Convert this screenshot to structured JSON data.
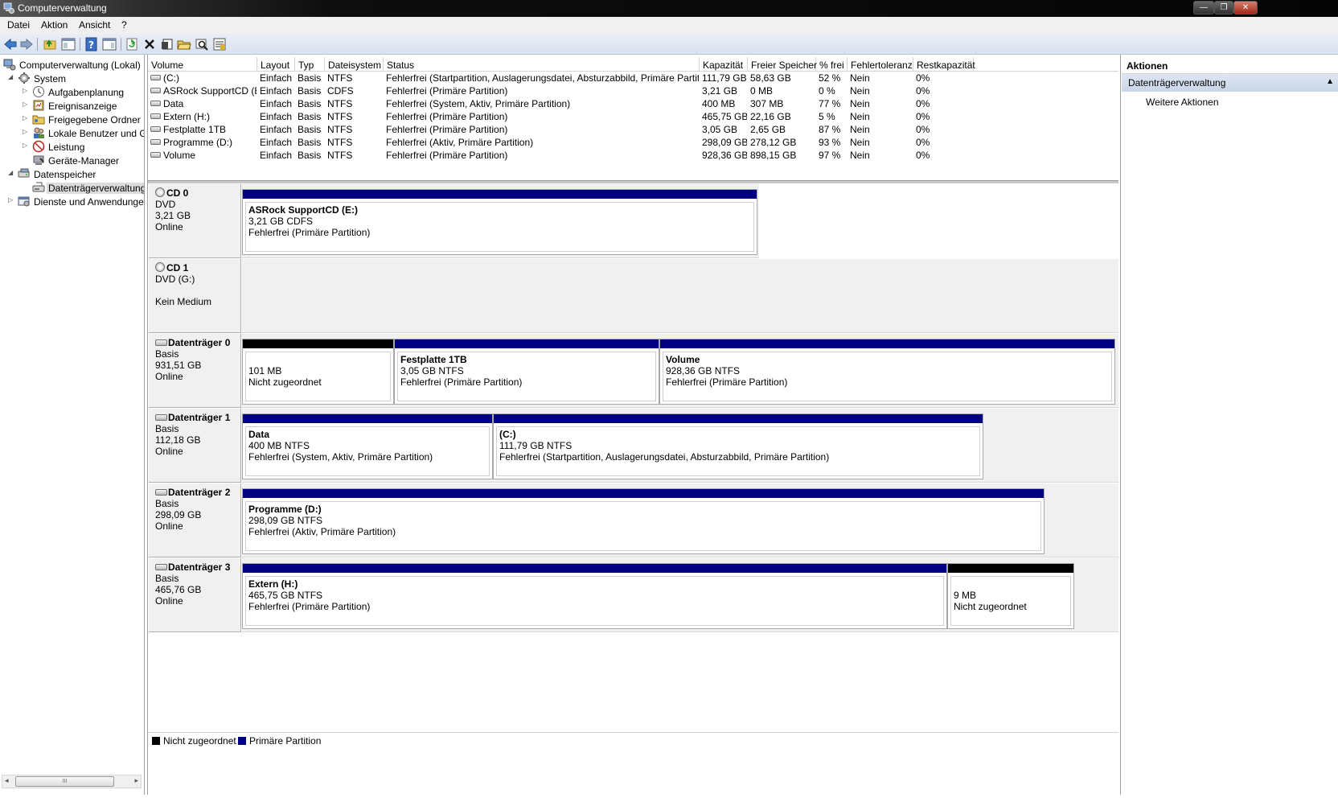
{
  "window": {
    "title": "Computerverwaltung",
    "buttons": [
      "—",
      "❐",
      "✕"
    ]
  },
  "menubar": {
    "items": [
      "Datei",
      "Aktion",
      "Ansicht",
      "?"
    ]
  },
  "tree": {
    "items": [
      {
        "label": "Computerverwaltung (Lokal)",
        "icon": "computer-management-icon",
        "expand": ""
      },
      {
        "label": "System",
        "icon": "system-icon",
        "expand": "◢"
      },
      {
        "label": "Aufgabenplanung",
        "icon": "clock-icon",
        "expand": "▷"
      },
      {
        "label": "Ereignisanzeige",
        "icon": "event-viewer-icon",
        "expand": "▷"
      },
      {
        "label": "Freigegebene Ordner",
        "icon": "shared-folder-icon",
        "expand": "▷"
      },
      {
        "label": "Lokale Benutzer und Gruppen",
        "icon": "users-icon",
        "expand": "▷"
      },
      {
        "label": "Leistung",
        "icon": "performance-icon",
        "expand": "▷"
      },
      {
        "label": "Geräte-Manager",
        "icon": "device-manager-icon",
        "expand": ""
      },
      {
        "label": "Datenspeicher",
        "icon": "storage-icon",
        "expand": "◢"
      },
      {
        "label": "Datenträgerverwaltung",
        "icon": "disk-management-icon",
        "expand": ""
      },
      {
        "label": "Dienste und Anwendungen",
        "icon": "services-icon",
        "expand": "▷"
      }
    ],
    "scroll_label": "III"
  },
  "volumes": {
    "columns": [
      "Volume",
      "Layout",
      "Typ",
      "Dateisystem",
      "Status",
      "Kapazität",
      "Freier Speicher",
      "% frei",
      "Fehlertoleranz",
      "Restkapazität"
    ],
    "rows": [
      [
        "(C:)",
        "Einfach",
        "Basis",
        "NTFS",
        "Fehlerfrei (Startpartition, Auslagerungsdatei, Absturzabbild, Primäre Partition)",
        "111,79 GB",
        "58,63 GB",
        "52 %",
        "Nein",
        "0%"
      ],
      [
        "ASRock SupportCD (E:)",
        "Einfach",
        "Basis",
        "CDFS",
        "Fehlerfrei (Primäre Partition)",
        "3,21 GB",
        "0 MB",
        "0 %",
        "Nein",
        "0%"
      ],
      [
        "Data",
        "Einfach",
        "Basis",
        "NTFS",
        "Fehlerfrei (System, Aktiv, Primäre Partition)",
        "400 MB",
        "307 MB",
        "77 %",
        "Nein",
        "0%"
      ],
      [
        "Extern (H:)",
        "Einfach",
        "Basis",
        "NTFS",
        "Fehlerfrei (Primäre Partition)",
        "465,75 GB",
        "22,16 GB",
        "5 %",
        "Nein",
        "0%"
      ],
      [
        "Festplatte 1TB",
        "Einfach",
        "Basis",
        "NTFS",
        "Fehlerfrei (Primäre Partition)",
        "3,05 GB",
        "2,65 GB",
        "87 %",
        "Nein",
        "0%"
      ],
      [
        "Programme (D:)",
        "Einfach",
        "Basis",
        "NTFS",
        "Fehlerfrei (Aktiv, Primäre Partition)",
        "298,09 GB",
        "278,12 GB",
        "93 %",
        "Nein",
        "0%"
      ],
      [
        "Volume",
        "Einfach",
        "Basis",
        "NTFS",
        "Fehlerfrei (Primäre Partition)",
        "928,36 GB",
        "898,15 GB",
        "97 %",
        "Nein",
        "0%"
      ]
    ]
  },
  "disks": [
    {
      "name": "CD 0",
      "kind": "DVD",
      "size": "3,21 GB",
      "state": "Online",
      "type": "cd",
      "partitions": [
        {
          "bar": "primary",
          "name": "ASRock SupportCD  (E:)",
          "size": "3,21 GB CDFS",
          "status": "Fehlerfrei (Primäre Partition)"
        }
      ]
    },
    {
      "name": "CD 1",
      "kind": "DVD (G:)",
      "size": "",
      "state": "Kein Medium",
      "type": "cd",
      "partitions": []
    },
    {
      "name": "Datenträger 0",
      "kind": "Basis",
      "size": "931,51 GB",
      "state": "Online",
      "type": "hdd",
      "partitions": [
        {
          "bar": "unalloc",
          "name": "",
          "size": "101 MB",
          "status": "Nicht zugeordnet"
        },
        {
          "bar": "primary",
          "name": "Festplatte 1TB",
          "size": "3,05 GB NTFS",
          "status": "Fehlerfrei (Primäre Partition)"
        },
        {
          "bar": "primary",
          "name": "Volume",
          "size": "928,36 GB NTFS",
          "status": "Fehlerfrei (Primäre Partition)"
        }
      ]
    },
    {
      "name": "Datenträger 1",
      "kind": "Basis",
      "size": "112,18 GB",
      "state": "Online",
      "type": "hdd",
      "partitions": [
        {
          "bar": "primary",
          "name": "Data",
          "size": "400 MB NTFS",
          "status": "Fehlerfrei (System, Aktiv, Primäre Partition)"
        },
        {
          "bar": "primary",
          "name": " (C:)",
          "size": "111,79 GB NTFS",
          "status": "Fehlerfrei (Startpartition, Auslagerungsdatei, Absturzabbild, Primäre Partition)"
        }
      ]
    },
    {
      "name": "Datenträger 2",
      "kind": "Basis",
      "size": "298,09 GB",
      "state": "Online",
      "type": "hdd",
      "partitions": [
        {
          "bar": "primary",
          "name": "Programme  (D:)",
          "size": "298,09 GB NTFS",
          "status": "Fehlerfrei (Aktiv, Primäre Partition)"
        }
      ]
    },
    {
      "name": "Datenträger 3",
      "kind": "Basis",
      "size": "465,76 GB",
      "state": "Online",
      "type": "hdd",
      "partitions": [
        {
          "bar": "primary",
          "name": "Extern  (H:)",
          "size": "465,75 GB NTFS",
          "status": "Fehlerfrei (Primäre Partition)"
        },
        {
          "bar": "unalloc",
          "name": "",
          "size": "9 MB",
          "status": "Nicht zugeordnet"
        }
      ]
    }
  ],
  "legend": {
    "unallocated": "Nicht zugeordnet",
    "primary": "Primäre Partition",
    "unallocated_color": "#000000",
    "primary_color": "#000080"
  },
  "actions": {
    "title": "Aktionen",
    "section": "Datenträgerverwaltung",
    "more": "Weitere Aktionen"
  }
}
